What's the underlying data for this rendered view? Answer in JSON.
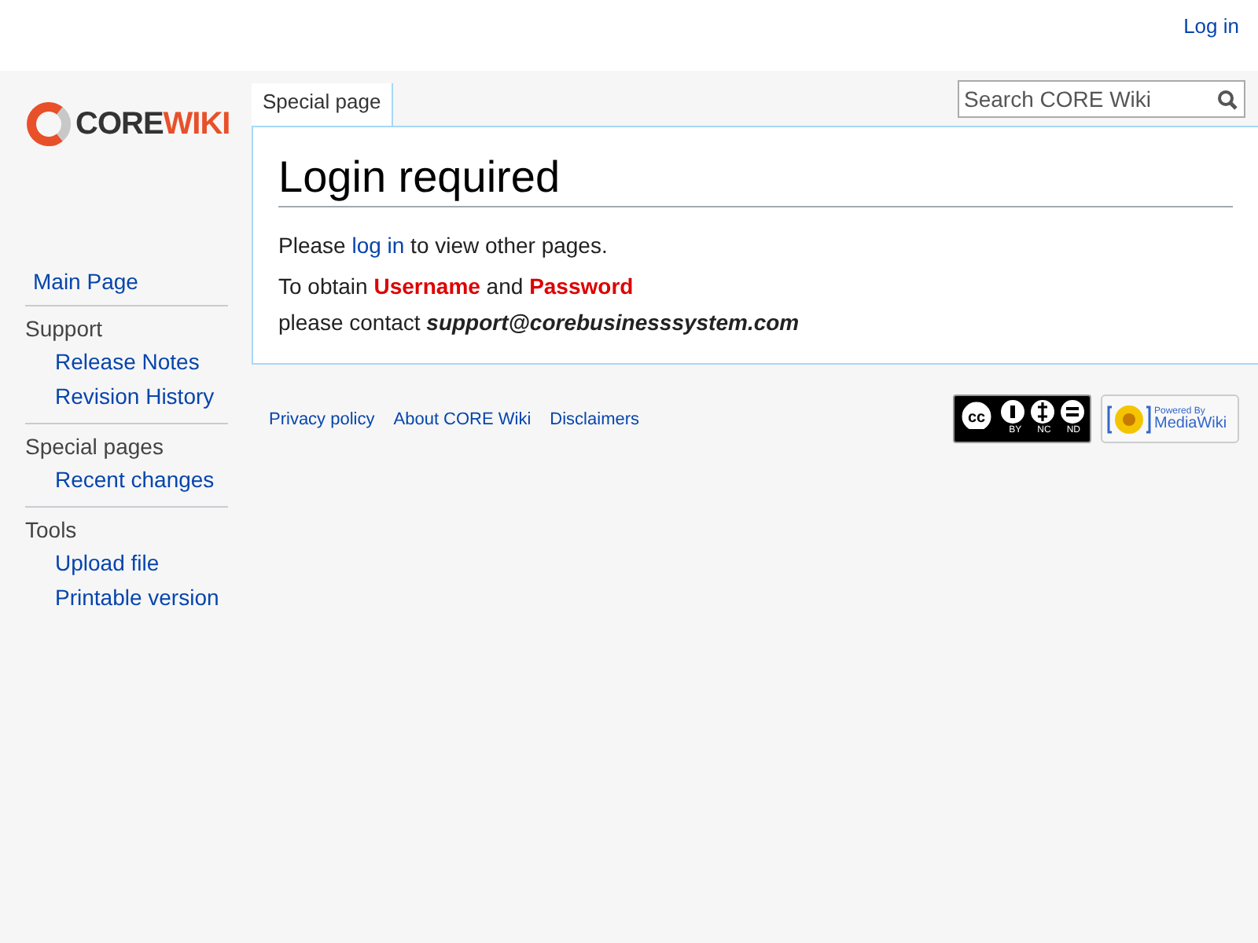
{
  "personal_tools": [
    {
      "label": "Log in"
    }
  ],
  "logo": {
    "part_1": "CORE",
    "part_2": "WIKI"
  },
  "tabs": [
    {
      "label": "Special page",
      "selected": true
    }
  ],
  "search": {
    "placeholder": "Search CORE Wiki"
  },
  "sidebar": {
    "top": [
      {
        "label": "Main Page"
      }
    ],
    "sections": [
      {
        "heading": "Support",
        "items": [
          {
            "label": "Release Notes"
          },
          {
            "label": "Revision History"
          }
        ]
      },
      {
        "heading": "Special pages",
        "items": [
          {
            "label": "Recent changes"
          }
        ]
      },
      {
        "heading": "Tools",
        "items": [
          {
            "label": "Upload file"
          },
          {
            "label": "Printable version"
          }
        ]
      }
    ]
  },
  "page": {
    "title": "Login required",
    "line_1": {
      "before": "Please ",
      "link": "log in",
      "after": " to view other pages."
    },
    "line_2": "To obtain **Username** and **Password**",
    "line_3": "please contact *support@corebusinesssystem.com*"
  },
  "footer": {
    "links": [
      {
        "label": "Privacy policy"
      },
      {
        "label": "About CORE Wiki"
      },
      {
        "label": "Disclaimers"
      }
    ],
    "license_badge": {
      "mark": "cc",
      "labels": [
        "BY",
        "NC",
        "ND"
      ]
    },
    "powered_badge": {
      "line_1": "Powered By",
      "line_2": "MediaWiki"
    }
  }
}
